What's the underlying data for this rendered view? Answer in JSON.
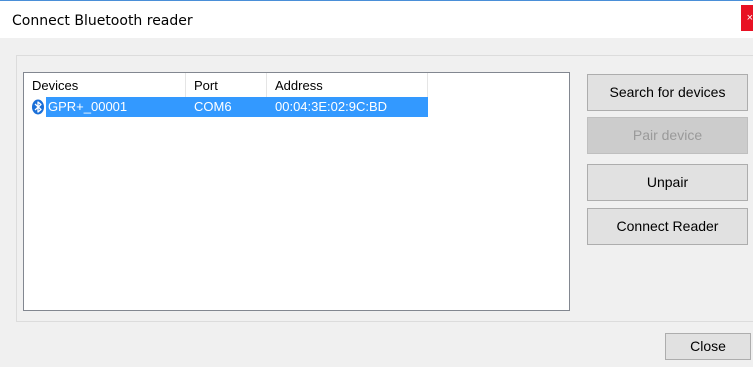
{
  "window": {
    "title": "Connect Bluetooth reader",
    "close_glyph": "×"
  },
  "device_list": {
    "columns": [
      "Devices",
      "Port",
      "Address"
    ],
    "rows": [
      {
        "device": "GPR+_00001",
        "port": "COM6",
        "address": "00:04:3E:02:9C:BD",
        "icon": "bluetooth-icon",
        "selected": true
      }
    ]
  },
  "buttons": {
    "search": "Search for devices",
    "pair": "Pair device",
    "unpair": "Unpair",
    "connect": "Connect Reader",
    "close": "Close"
  },
  "colors": {
    "selection": "#3399ff",
    "close_button": "#e81123",
    "bluetooth": "#1a6fd8"
  }
}
